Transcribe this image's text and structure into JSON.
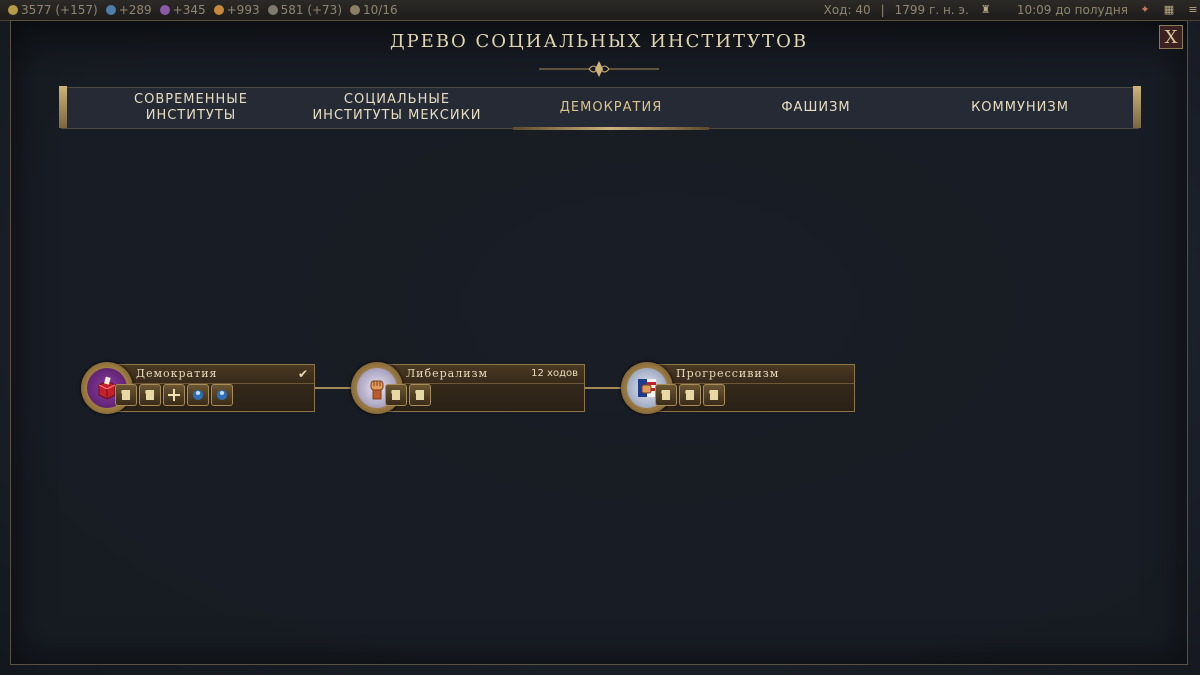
{
  "topbar": {
    "gold": "3577 (+157)",
    "science": "+289",
    "culture": "+345",
    "faith": "+993",
    "tourism": "581 (+73)",
    "trade": "10/16",
    "turn": "Ход: 40",
    "date": "1799 г. н. э.",
    "clock": "10:09 до полудня"
  },
  "dialog": {
    "title": "ДРЕВО СОЦИАЛЬНЫХ ИНСТИТУТОВ",
    "close_label": "X"
  },
  "tabs": [
    {
      "label": "СОВРЕМЕННЫЕ\nИНСТИТУТЫ"
    },
    {
      "label": "СОЦИАЛЬНЫЕ\nИНСТИТУТЫ МЕКСИКИ"
    },
    {
      "label": "ДЕМОКРАТИЯ"
    },
    {
      "label": "ФАШИЗМ"
    },
    {
      "label": "КОММУНИЗМ"
    }
  ],
  "active_tab": "ДЕМОКРАТИЯ",
  "tree": {
    "nodes": [
      {
        "name": "Демократия",
        "status": "completed",
        "icon": "ballot-box-icon",
        "unlocks": [
          "scroll-icon",
          "scroll-icon",
          "plus-icon",
          "great-person-icon",
          "great-person-icon"
        ]
      },
      {
        "name": "Либерализм",
        "turns": "12 ходов",
        "icon": "raised-fist-icon",
        "unlocks": [
          "scroll-icon",
          "scroll-icon"
        ]
      },
      {
        "name": "Прогрессивизм",
        "icon": "flag-fist-icon",
        "unlocks": [
          "scroll-icon",
          "scroll-icon",
          "scroll-icon"
        ]
      }
    ]
  },
  "colors": {
    "gold_accent": "#cdb27a",
    "panel_brown": "#3a2d1c",
    "democracy_purple": "#7b2f8f"
  }
}
